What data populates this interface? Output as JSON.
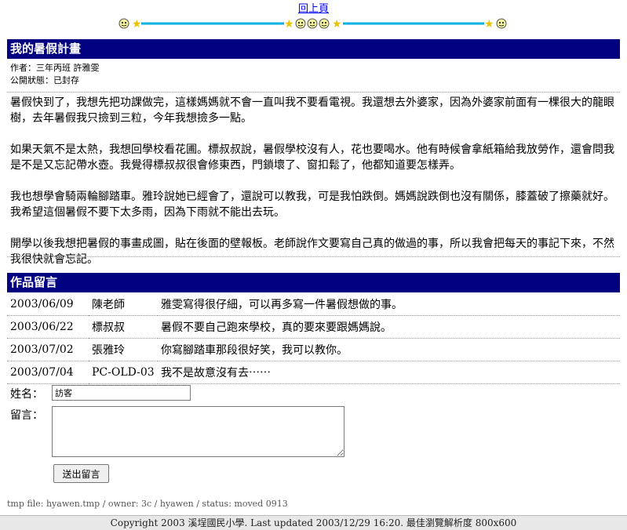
{
  "nav": {
    "back_to_top": "回上頁"
  },
  "colors": {
    "header_bg": "#000080",
    "line": "#00b0e0",
    "star": "#ffd700"
  },
  "icons": [
    "smiley-icon",
    "star-icon"
  ],
  "post": {
    "title": "我的暑假計畫",
    "author_line": "作者：三年丙班 許雅雯",
    "status_line": "公開狀態：已封存",
    "paragraphs": [
      "暑假快到了，我想先把功課做完，這樣媽媽就不會一直叫我不要看電視。我還想去外婆家，因為外婆家前面有一棵很大的龍眼樹，去年暑假我只撿到三粒，今年我想撿多一點。",
      "如果天氣不是太熱，我想回學校看花圃。標叔叔說，暑假學校沒有人，花也要喝水。他有時候會拿紙箱給我放勞作，還會問我是不是又忘記帶水壺。我覺得標叔叔很會修東西，門鎖壞了、窗扣鬆了，他都知道要怎樣弄。",
      "我也想學會騎兩輪腳踏車。雅玲說她已經會了，還說可以教我，可是我怕跌倒。媽媽說跌倒也沒有關係，膝蓋破了擦藥就好。我希望這個暑假不要下太多雨，因為下雨就不能出去玩。",
      "開學以後我想把暑假的事畫成圖，貼在後面的壁報板。老師說作文要寫自己真的做過的事，所以我會把每天的事記下來，不然我很快就會忘記。"
    ]
  },
  "comments_section": {
    "title": "作品留言",
    "rows": [
      {
        "date": "2003/06/09",
        "author": "陳老師",
        "text": "雅雯寫得很仔細，可以再多寫一件暑假想做的事。"
      },
      {
        "date": "2003/06/22",
        "author": "標叔叔",
        "text": "暑假不要自己跑來學校，真的要來要跟媽媽說。"
      },
      {
        "date": "2003/07/02",
        "author": "張雅玲",
        "text": "你寫腳踏車那段很好笑，我可以教你。"
      },
      {
        "date": "2003/07/04",
        "author": "PC-OLD-03",
        "text": "我不是故意沒有去⋯⋯"
      }
    ]
  },
  "form": {
    "name_label": "姓名：",
    "name_value": "訪客",
    "message_label": "留言：",
    "message_value": "",
    "submit_label": "送出留言"
  },
  "tmp_line": "tmp file: hyawen.tmp / owner: 3c / hyawen / status: moved 0913",
  "footer": "Copyright 2003 溪埕國民小學. Last updated 2003/12/29 16:20. 最佳瀏覽解析度 800x600"
}
